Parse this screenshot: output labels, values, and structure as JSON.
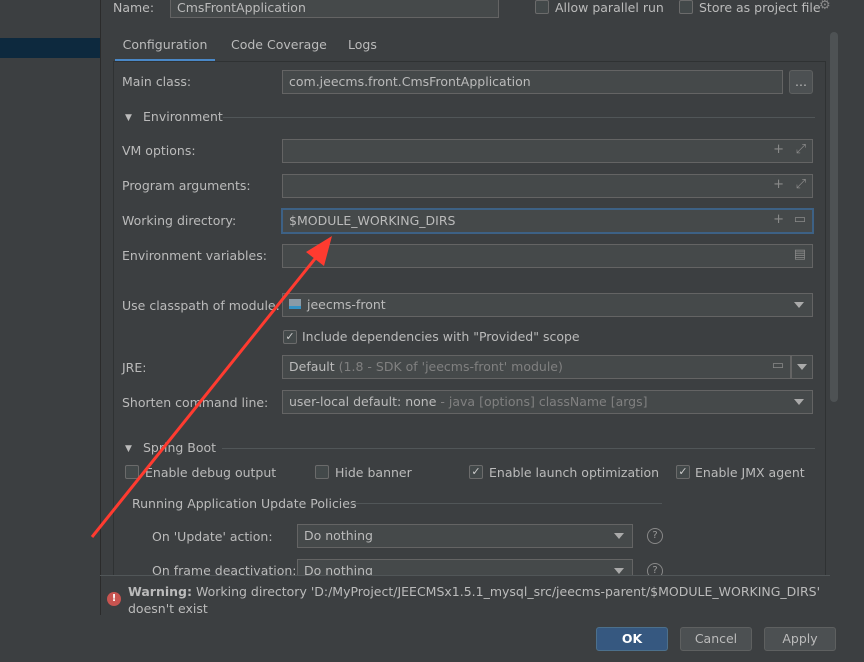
{
  "header": {
    "name_label": "Name:",
    "name_value": "CmsFrontApplication",
    "allow_parallel": "Allow parallel run",
    "store_project": "Store as project file"
  },
  "tabs": [
    {
      "label": "Configuration"
    },
    {
      "label": "Code Coverage"
    },
    {
      "label": "Logs"
    }
  ],
  "form": {
    "main_class_label": "Main class:",
    "main_class_value": "com.jeecms.front.CmsFrontApplication",
    "browse": "...",
    "environment": "Environment",
    "vm_label": "VM options:",
    "prog_label": "Program arguments:",
    "wd_label": "Working directory:",
    "wd_value": "$MODULE_WORKING_DIRS",
    "env_label": "Environment variables:",
    "classpath_label": "Use classpath of module:",
    "classpath_value": "jeecms-front",
    "include_deps": "Include dependencies with \"Provided\" scope",
    "jre_label": "JRE:",
    "jre_value": "Default",
    "jre_hint": "(1.8 - SDK of 'jeecms-front' module)",
    "shorten_label": "Shorten command line:",
    "shorten_value": "user-local default: none",
    "shorten_hint": "- java [options] className [args]",
    "spring_boot": "Spring Boot",
    "debug": "Enable debug output",
    "hide_banner": "Hide banner",
    "launch_opt": "Enable launch optimization",
    "jmx": "Enable JMX agent",
    "policies": "Running Application Update Policies",
    "update_label": "On 'Update' action:",
    "update_value": "Do nothing",
    "frame_label": "On frame deactivation:",
    "frame_value": "Do nothing"
  },
  "warning": {
    "bold": "Warning:",
    "text": "Working directory 'D:/MyProject/JEECMSx1.5.1_mysql_src/jeecms-parent/$MODULE_WORKING_DIRS' doesn't exist"
  },
  "buttons": {
    "ok": "OK",
    "cancel": "Cancel",
    "apply": "Apply"
  }
}
